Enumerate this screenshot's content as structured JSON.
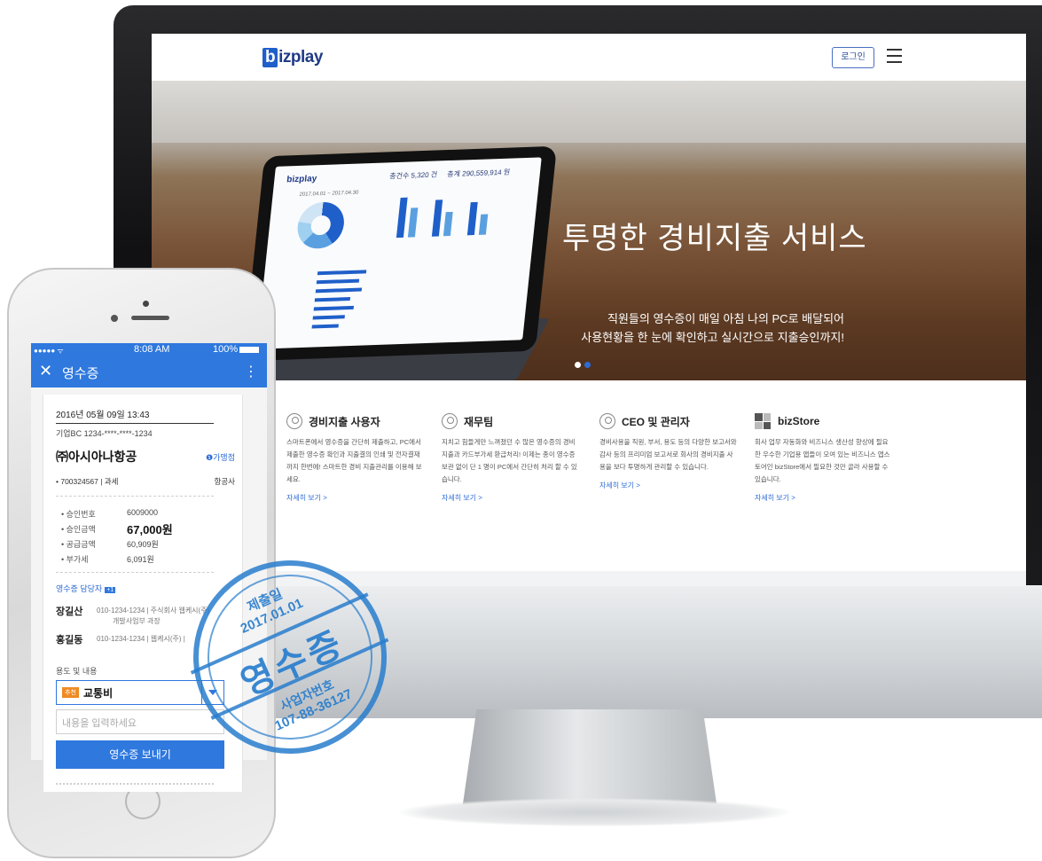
{
  "site": {
    "logo": "bizplay",
    "login_label": "로그인",
    "hero_title": "투명한 경비지출 서비스",
    "hero_sub_line1": "직원들의 영수증이 매일 아침 나의 PC로 배달되어",
    "hero_sub_line2": "사용현황을 한 눈에 확인하고 실시간으로 지출승인까지!",
    "tablet": {
      "logo": "bizplay",
      "stat1": "총건수 5,320 건",
      "stat2": "총계 290,559,914 원",
      "date": "2017.04.01 ~ 2017.04.30"
    },
    "features": [
      {
        "title": "경비지출 사용자",
        "desc": "스마트폰에서 영수증을 간단히 제출하고, PC에서 제출한 영수증 확인과 지출결의 인쇄 및 전자결재까지 한번에! 스마트한 경비 지출관리를 이용해 보세요.",
        "link": "자세히 보기 >"
      },
      {
        "title": "재무팀",
        "desc": "지치고 힘들게만 느껴졌던 수 많은 영수증의 경비지출과 카드부가세 환급처리! 이제는 종이 영수증 보관 없이 단 1 명이 PC에서 간단히 처리 할 수 있습니다.",
        "link": "자세히 보기 >"
      },
      {
        "title": "CEO 및 관리자",
        "desc": "경비사용을 직원, 부서, 용도 등의 다양한 보고서와 감사 등의 프리미엄 보고서로 회사의 경비지출 사용을 보다 투명하게 관리할 수 있습니다.",
        "link": "자세히 보기 >"
      },
      {
        "title": "bizStore",
        "desc": "회사 업무 자동화와 비즈니스 생산성 향상에 필요한 우수한 기업용 앱들이 모여 있는 비즈니스 앱스토어인 bizStore에서 필요한 것만 골라 사용할 수 있습니다.",
        "link": "자세히 보기 >"
      }
    ]
  },
  "phone": {
    "status_signal": "●●●●● ᯤ",
    "status_time": "8:08 AM",
    "status_battery": "100%",
    "app_title": "영수증",
    "receipt": {
      "datetime": "2016년 05월 09일 13:43",
      "card": "기업BC 1234-****-****-1234",
      "merchant": "㈜아시아나항공",
      "merchant_link": "가맹점",
      "biz_no": "• 700324567  |  과세",
      "category": "항공사",
      "rows": [
        {
          "label": "• 승인번호",
          "value": "6009000"
        },
        {
          "label": "• 승인금액",
          "value": "67,000원"
        },
        {
          "label": "• 공급금액",
          "value": "60,909원"
        },
        {
          "label": "• 부가세",
          "value": "6,091원"
        }
      ],
      "manager_label": "영수증 담당자",
      "manager_badge": "+1",
      "persons": [
        {
          "name": "장길산",
          "detail": "010-1234-1234  |  주식회사 웹케시(주)",
          "detail2": "개발사업부 과장"
        },
        {
          "name": "홍길동",
          "detail": "010-1234-1234  |  웹케시(주)  |",
          "detail2": ""
        }
      ],
      "purpose_label": "용도 및 내용",
      "purpose_tag": "추천",
      "purpose_value": "교통비",
      "content_placeholder": "내용을 입력하세요",
      "send_label": "영수증 보내기"
    }
  },
  "stamp": {
    "line1": "제출일",
    "line2": "2017.01.01",
    "big": "영수증",
    "line3": "사업자번호",
    "line4": "107-88-36127"
  },
  "colors": {
    "brand": "#1f3b87",
    "accent": "#2e78de",
    "stamp": "#287dcd"
  }
}
